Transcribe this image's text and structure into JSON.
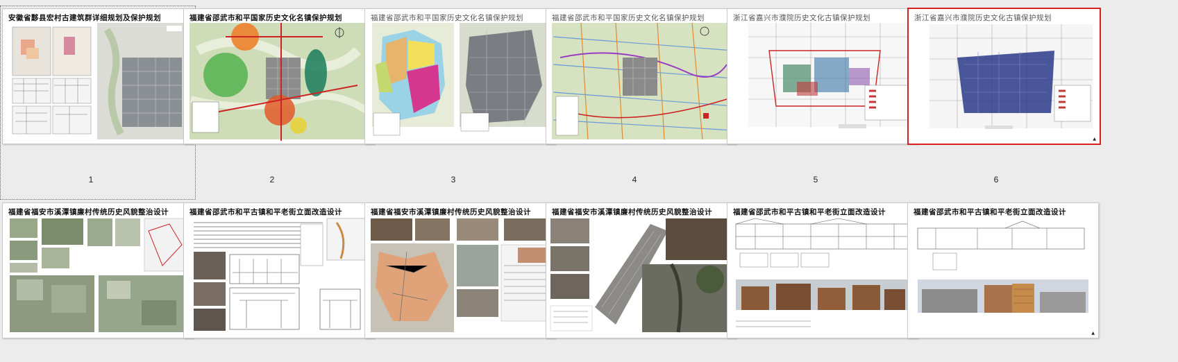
{
  "slides_row1": [
    {
      "number": "1",
      "title": "安徽省黟县宏村古建筑群详细规划及保护规划"
    },
    {
      "number": "2",
      "title": "福建省邵武市和平国家历史文化名镇保护规划"
    },
    {
      "number": "3",
      "title": "福建省邵武市和平国家历史文化名镇保护规划"
    },
    {
      "number": "4",
      "title": "福建省邵武市和平国家历史文化名镇保护规划"
    },
    {
      "number": "5",
      "title": "浙江省嘉兴市濮院历史文化古镇保护规划"
    },
    {
      "number": "6",
      "title": "浙江省嘉兴市濮院历史文化古镇保护规划"
    }
  ],
  "slides_row2": [
    {
      "title": "福建省福安市溪潭镇廉村传统历史风貌整治设计"
    },
    {
      "title": "福建省邵武市和平古镇和平老街立面改造设计"
    },
    {
      "title": "福建省福安市溪潭镇廉村传统历史风貌整治设计"
    },
    {
      "title": "福建省福安市溪潭镇廉村传统历史风貌整治设计"
    },
    {
      "title": "福建省邵武市和平古镇和平老街立面改造设计"
    },
    {
      "title": "福建省邵武市和平古镇和平老街立面改造设计"
    }
  ],
  "selected_slide": "6",
  "colors": {
    "selection": "#d42222",
    "background": "#ececec",
    "map_green": "#cfdcb8"
  },
  "icons": [
    "north-arrow-icon",
    "legend-icon"
  ]
}
